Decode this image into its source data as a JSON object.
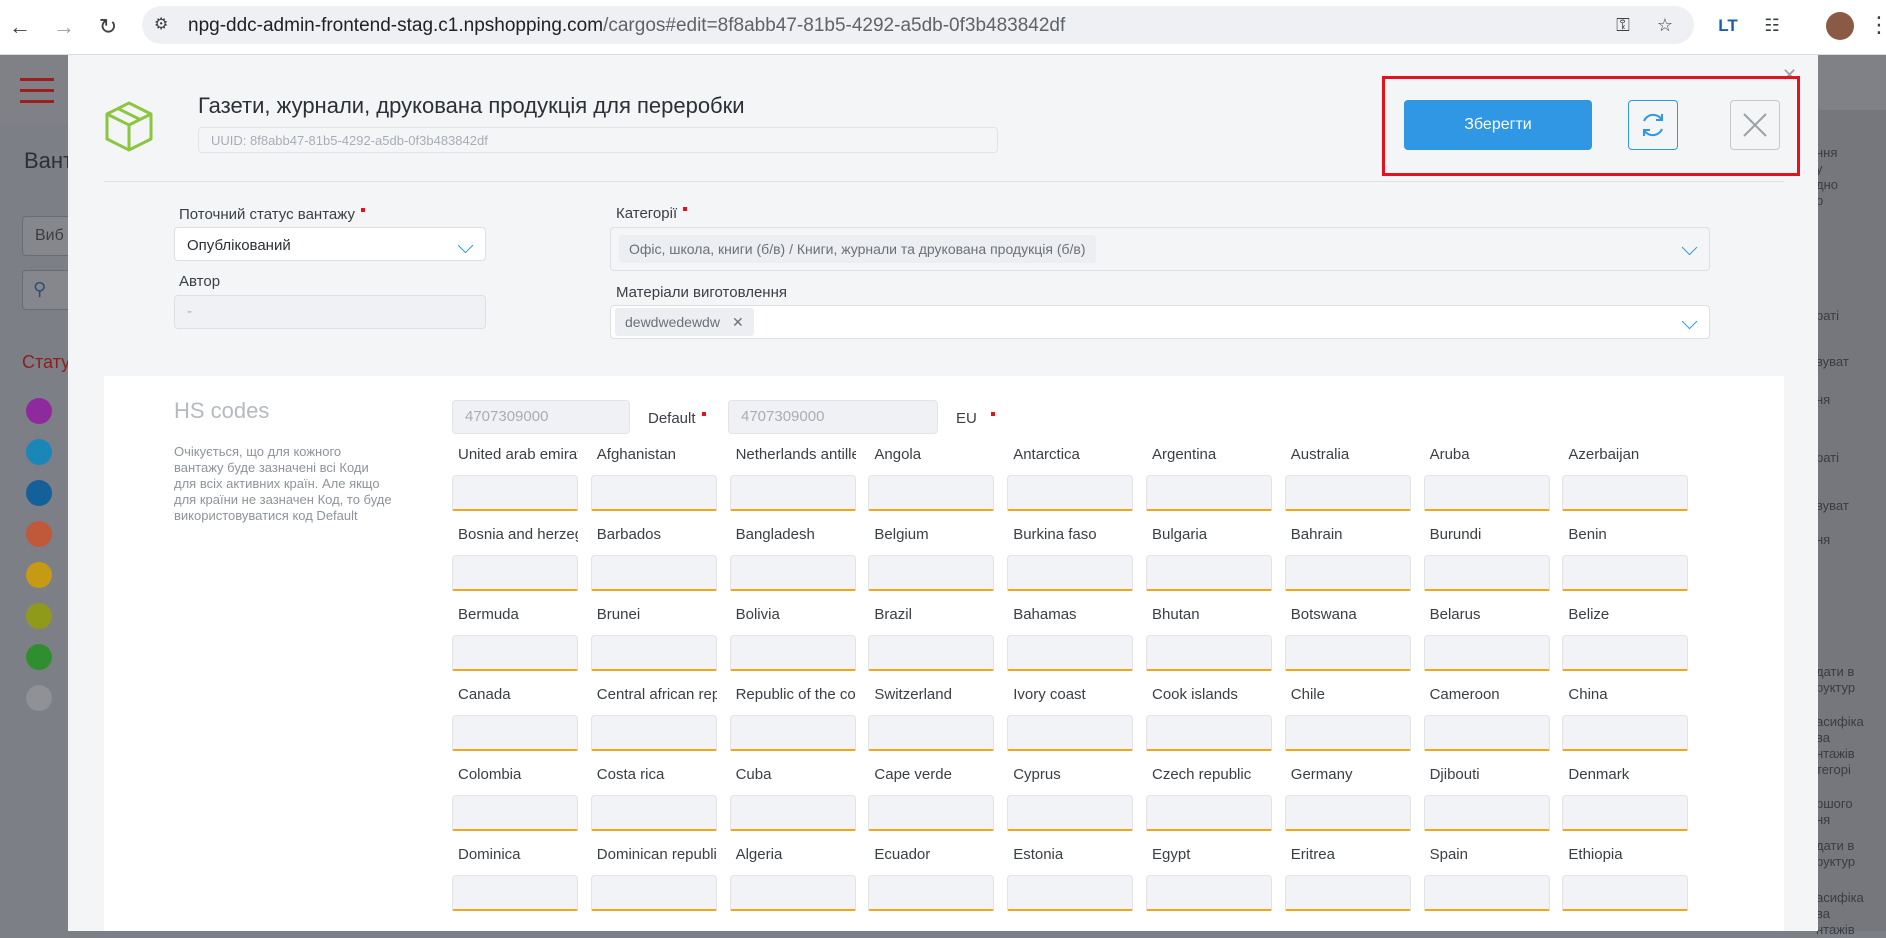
{
  "browser": {
    "url_host": "npg-ddc-admin-frontend-stag.c1.npshopping.com",
    "url_rest": "/cargos#edit=8f8abb47-81b5-4292-a5db-0f3b483842df",
    "ext_label": "LT"
  },
  "background": {
    "title": "Вант",
    "select_text": "Виб",
    "status_label": "Стату",
    "dot_colors": [
      "#8e2a9e",
      "#1b86b8",
      "#14609a",
      "#c0583a",
      "#c79a14",
      "#8f9a1a",
      "#2f8e2f",
      "#8f9197"
    ],
    "right_texts": [
      "ння\nу\nдно\nо",
      "раті",
      "вуват",
      "ня",
      "раті",
      "вуват",
      "ня",
      "дати в\nруктур",
      "асифіка\nва\nнтажів\nтегорі",
      "ршого\nня",
      "дати в\nруктур",
      "асифіка\nва\nнтажів"
    ]
  },
  "modal": {
    "title": "Газети, журнали, друкована продукція для переробки",
    "uuid": "UUID: 8f8abb47-81b5-4292-a5db-0f3b483842df",
    "save_label": "Зберегти",
    "status": {
      "label": "Поточний статус вантажу",
      "value": "Опублікований"
    },
    "author": {
      "label": "Автор",
      "value": "-"
    },
    "categories": {
      "label": "Категорії",
      "value": "Офіс, школа, книги (б/в) / Книги, журнали та друкована продукція (б/в)"
    },
    "materials": {
      "label": "Матеріали виготовлення",
      "chip": "dewdwedewdw"
    },
    "accent_color": "#2f97e3",
    "highlight_color": "#e3121e"
  },
  "hs": {
    "title": "HS codes",
    "description": "Очікується, що для кожного вантажу буде зазначені всі Коди для всіх активних країн. Але якщо для країни не зазначен Код, то буде використовуватися код Default",
    "default_value": "4707309000",
    "default_label": "Default",
    "eu_value": "4707309000",
    "eu_label": "EU",
    "countries": [
      "United arab emirates",
      "Afghanistan",
      "Netherlands antilles",
      "Angola",
      "Antarctica",
      "Argentina",
      "Australia",
      "Aruba",
      "Azerbaijan",
      "Bosnia and herzegovina",
      "Barbados",
      "Bangladesh",
      "Belgium",
      "Burkina faso",
      "Bulgaria",
      "Bahrain",
      "Burundi",
      "Benin",
      "Bermuda",
      "Brunei",
      "Bolivia",
      "Brazil",
      "Bahamas",
      "Bhutan",
      "Botswana",
      "Belarus",
      "Belize",
      "Canada",
      "Central african republic",
      "Republic of the congo",
      "Switzerland",
      "Ivory coast",
      "Cook islands",
      "Chile",
      "Cameroon",
      "China",
      "Colombia",
      "Costa rica",
      "Cuba",
      "Cape verde",
      "Cyprus",
      "Czech republic",
      "Germany",
      "Djibouti",
      "Denmark",
      "Dominica",
      "Dominican republic",
      "Algeria",
      "Ecuador",
      "Estonia",
      "Egypt",
      "Eritrea",
      "Spain",
      "Ethiopia"
    ]
  }
}
